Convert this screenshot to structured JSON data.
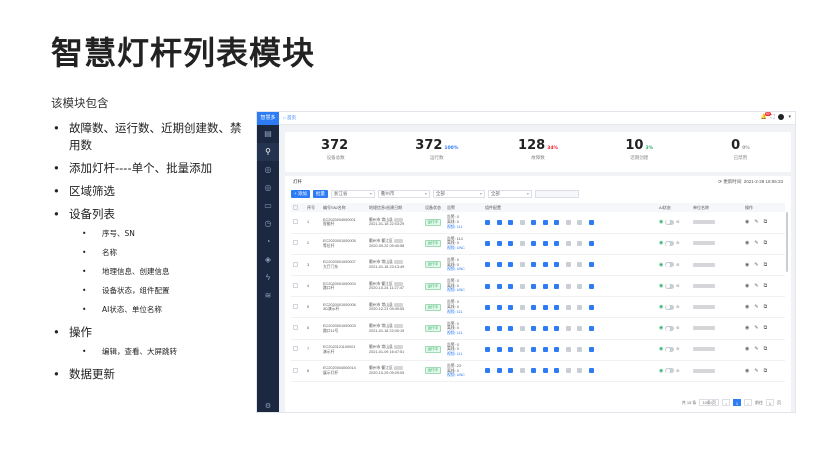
{
  "slide": {
    "title": "智慧灯杆列表模块",
    "intro": "该模块包含",
    "bullets": [
      {
        "text": "故障数、运行数、近期创建数、禁用数",
        "sub": []
      },
      {
        "text": "添加灯杆----单个、批量添加",
        "sub": []
      },
      {
        "text": "区域筛选",
        "sub": []
      },
      {
        "text": "设备列表",
        "sub": [
          "序号、SN",
          "名称",
          "地理信息、创建信息",
          "设备状态，组件配置",
          "AI状态、单位名称"
        ]
      },
      {
        "text": "操作",
        "sub": [
          "编辑，查看、大屏跳转"
        ]
      },
      {
        "text": "数据更新",
        "sub": []
      }
    ]
  },
  "app": {
    "brand": "智慧多",
    "home_tab": "⌂ 首页",
    "notif_count": "99",
    "rail_icons": [
      "list-icon",
      "lamp-icon",
      "globe-icon",
      "globe-icon",
      "monitor-icon",
      "clock-icon",
      "pie-icon",
      "layers-icon",
      "bolt-icon",
      "stack-icon"
    ],
    "stats": [
      {
        "value": "372",
        "pct": "",
        "pct_color": "",
        "label": "设备总数"
      },
      {
        "value": "372",
        "pct": "100%",
        "pct_color": "#2d7cf6",
        "label": "运行数"
      },
      {
        "value": "128",
        "pct": "34%",
        "pct_color": "#f5222d",
        "label": "故障数"
      },
      {
        "value": "10",
        "pct": "3%",
        "pct_color": "#2fb36a",
        "label": "近期创建"
      },
      {
        "value": "0",
        "pct": "0%",
        "pct_color": "#999999",
        "label": "已禁用"
      }
    ],
    "panel": {
      "heading": "灯杆",
      "update_text": "⟳  更新时间: 2021-2-28 16:55:33",
      "add_single": "+ 添加",
      "add_batch": "批量",
      "filters": [
        "浙江省",
        "衢州市",
        "全部",
        "全部"
      ]
    },
    "table": {
      "headers": [
        "",
        "序号",
        "编号SN/名称",
        "地理信息/创建日期",
        "设备状态",
        "告警",
        "组件配置",
        "",
        "AI状态",
        "单位名称",
        "操作"
      ],
      "rows": [
        {
          "idx": "1",
          "sn": "EC2020004000001",
          "name": "智能杆",
          "geo": "衢州市 常山县",
          "date": "2021-01-18 22:03:29",
          "status": "运行中",
          "alarm1": "告警: 0",
          "alarm2": "离线: 0",
          "alarm3": "视频: 111"
        },
        {
          "idx": "2",
          "sn": "EC2020001000005",
          "name": "等位杆",
          "geo": "衢州市 衢江区",
          "date": "2020-09-22 09:40:58",
          "status": "运行中",
          "alarm1": "告警: 114",
          "alarm2": "离线: 0",
          "alarm3": "视频: UNC"
        },
        {
          "idx": "3",
          "sn": "EC2020001000007",
          "name": "大厅门东",
          "geo": "衢州市 常山县",
          "date": "2021-01-18 23:13:49",
          "status": "运行中",
          "alarm1": "告警: 0",
          "alarm2": "离线: 0",
          "alarm3": "视频: UNC"
        },
        {
          "idx": "4",
          "sn": "EC2020001000004",
          "name": "路口杆",
          "geo": "衢州市 衢江区",
          "date": "2020-10-24 11:27:47",
          "status": "运行中",
          "alarm1": "告警: 0",
          "alarm2": "离线: 0",
          "alarm3": "视频: UNC"
        },
        {
          "idx": "5",
          "sn": "EC2020001000006",
          "name": "3D演示杆",
          "geo": "衢州市 常山县",
          "date": "2020-12-21 09:49:55",
          "status": "运行中",
          "alarm1": "告警: 0",
          "alarm2": "离线: 0",
          "alarm3": "视频: 111"
        },
        {
          "idx": "6",
          "sn": "EC2020001000003",
          "name": "路口11号",
          "geo": "衢州市 常山县",
          "date": "2021-01-18 22:00:19",
          "status": "运行中",
          "alarm1": "告警: 0",
          "alarm2": "离线: 0",
          "alarm3": "视频: 111"
        },
        {
          "idx": "7",
          "sn": "EC2020121100001",
          "name": "演示杆",
          "geo": "衢州市 常山县",
          "date": "2021-01-09 16:47:51",
          "status": "运行中",
          "alarm1": "告警: 0",
          "alarm2": "离线: 0",
          "alarm3": "视频: 111"
        },
        {
          "idx": "8",
          "sn": "EC2020004000014",
          "name": "展示灯杆",
          "geo": "衢州市 衢江区",
          "date": "2020-10-29 09:29:05",
          "status": "运行中",
          "alarm1": "告警: 23",
          "alarm2": "离线: 0",
          "alarm3": "视频: UNC"
        }
      ]
    },
    "pager": {
      "total": "共 15 条",
      "page_size": "10条/页",
      "prev": "‹",
      "current": "1",
      "next": "›",
      "goto_label": "前往",
      "goto_value": "1",
      "page_unit": "页"
    }
  }
}
